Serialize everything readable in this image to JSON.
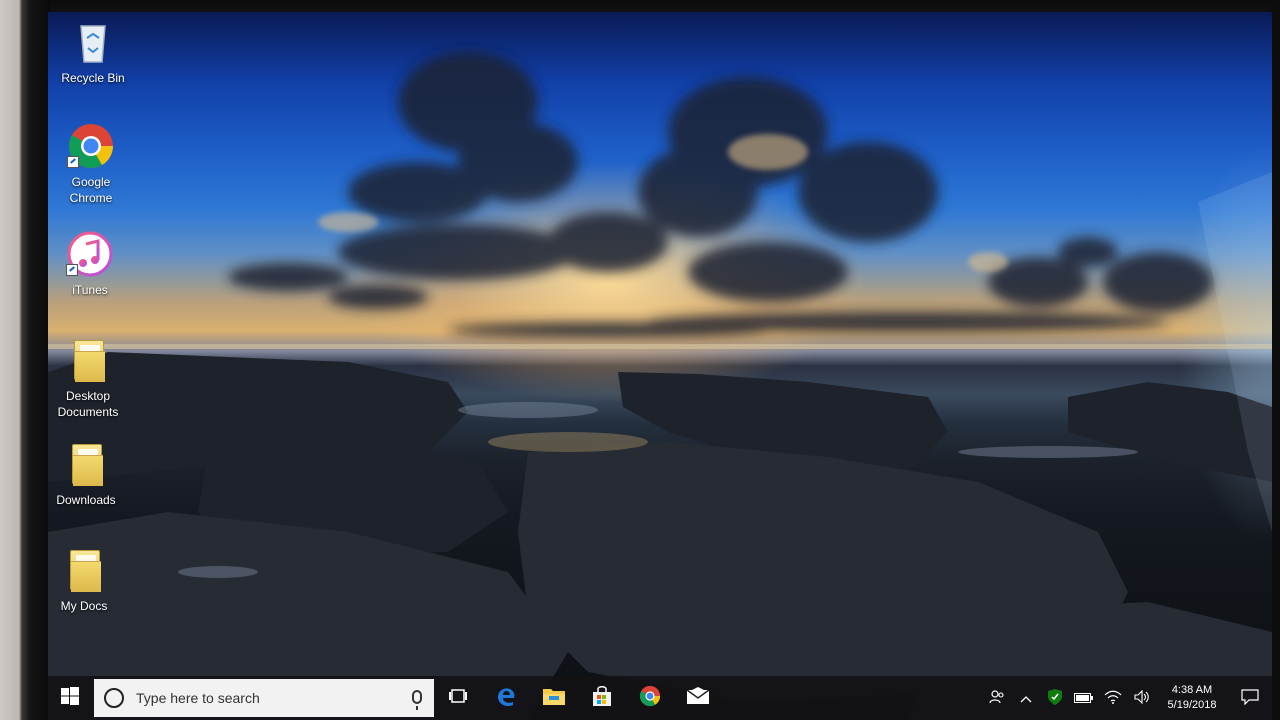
{
  "desktop": {
    "icons": [
      {
        "label": "Recycle Bin",
        "icon": "recycle-bin-icon"
      },
      {
        "label": "Google Chrome",
        "icon": "chrome-icon"
      },
      {
        "label": "iTunes",
        "icon": "itunes-icon"
      },
      {
        "label": "Desktop Documents",
        "icon": "folder-icon"
      },
      {
        "label": "Downloads",
        "icon": "folder-icon"
      },
      {
        "label": "My Docs",
        "icon": "folder-icon"
      }
    ]
  },
  "taskbar": {
    "start_icon": "windows-logo-icon",
    "search_placeholder": "Type here to search",
    "task_view_icon": "task-view-icon",
    "pinned_apps": [
      "edge-icon",
      "file-explorer-icon",
      "store-icon",
      "chrome-icon",
      "mail-icon"
    ]
  },
  "tray": {
    "icons": [
      "people-icon",
      "chevron-up-icon",
      "defender-icon",
      "battery-icon",
      "wifi-icon",
      "volume-icon"
    ],
    "time": "4:38 AM",
    "date": "5/19/2018",
    "action_center_icon": "notification-icon"
  },
  "colors": {
    "sky_top": "#0a1a55",
    "sky_mid": "#1e5fc8",
    "sunset": "#d9b070",
    "taskbar": "#121216",
    "edge_blue": "#1e78d8",
    "chrome_red": "#db4437",
    "chrome_yellow": "#f4c20d",
    "chrome_green": "#0f9d58"
  }
}
